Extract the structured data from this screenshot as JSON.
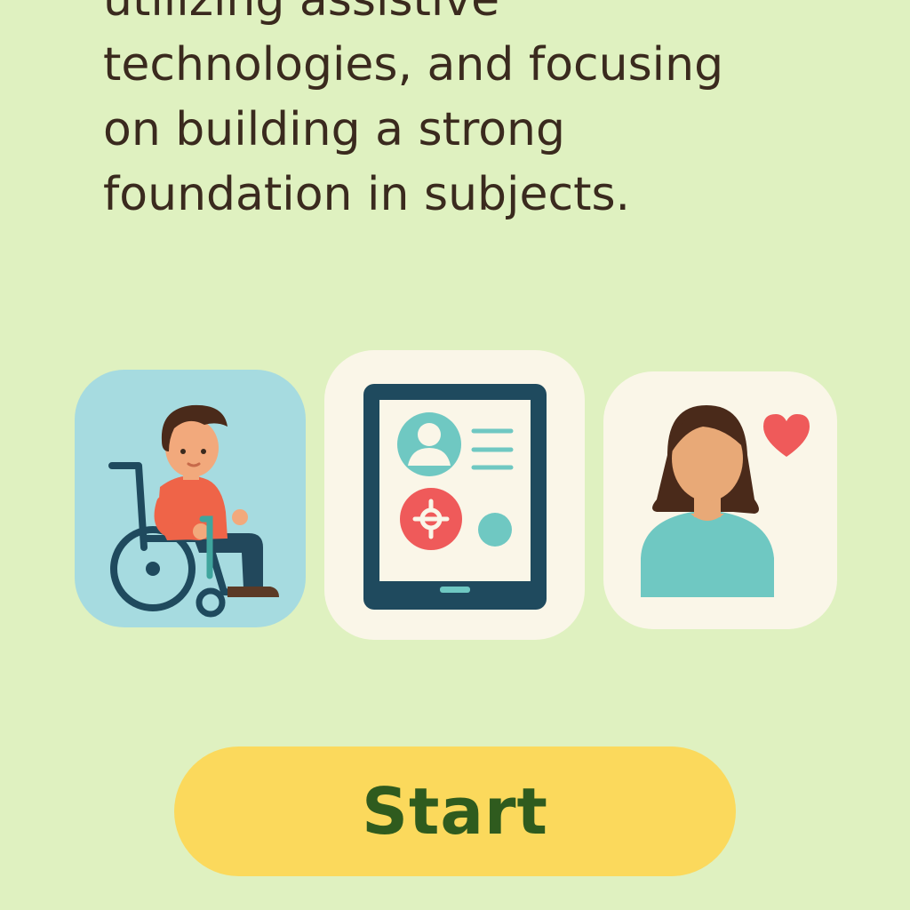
{
  "intro": {
    "lines": [
      "utilizing assistive",
      "technologies, and focusing",
      "on building a strong",
      "foundation in subjects."
    ]
  },
  "cards": [
    {
      "icon": "wheelchair-student-icon"
    },
    {
      "icon": "tablet-app-icon"
    },
    {
      "icon": "caring-person-icon"
    }
  ],
  "start_button": {
    "label": "Start"
  },
  "colors": {
    "background": "#dff1c0",
    "text": "#3a2a1e",
    "button": "#fbd95c",
    "button_text": "#2f5b1e",
    "teal": "#6fc8c2",
    "navy": "#1f4a5e",
    "coral": "#ef5a5a"
  }
}
